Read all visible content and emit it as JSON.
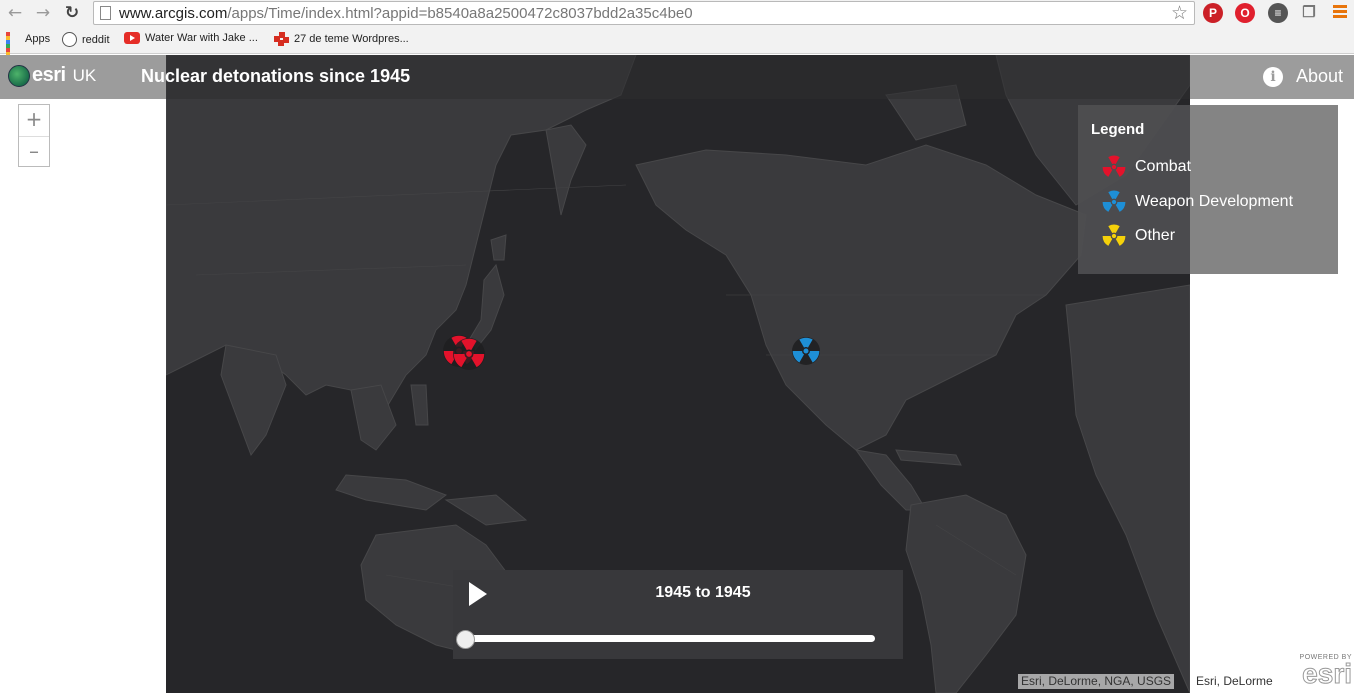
{
  "browser": {
    "url_host": "www.arcgis.com",
    "url_path": "/apps/Time/index.html?appid=b8540a8a2500472c8037bdd2a35c4be0",
    "bookmarks": [
      {
        "label": "Apps",
        "icon": "apps-grid-icon"
      },
      {
        "label": "reddit",
        "icon": "reddit-icon"
      },
      {
        "label": "Water War with Jake ...",
        "icon": "youtube-icon"
      },
      {
        "label": "27 de teme Wordpres...",
        "icon": "wordpress-icon"
      }
    ]
  },
  "header": {
    "logo_text": "esri",
    "logo_region": "UK",
    "title": "Nuclear detonations since 1945",
    "about_label": "About"
  },
  "zoom": {
    "in_label": "+",
    "out_label": "–"
  },
  "legend": {
    "title": "Legend",
    "items": [
      {
        "label": "Combat",
        "color": "#e3122b"
      },
      {
        "label": "Weapon Development",
        "color": "#1e8fd6"
      },
      {
        "label": "Other",
        "color": "#f5d10a"
      }
    ]
  },
  "markers": [
    {
      "category": "Combat",
      "color": "#e3122b"
    },
    {
      "category": "Combat",
      "color": "#e3122b"
    },
    {
      "category": "Weapon Development",
      "color": "#1e8fd6"
    }
  ],
  "time_slider": {
    "label": "1945 to 1945",
    "progress": 0
  },
  "attribution": {
    "primary": "Esri, DeLorme, NGA, USGS",
    "secondary": "Esri, DeLorme",
    "powered_by": "POWERED BY",
    "powered_logo": "esri"
  }
}
